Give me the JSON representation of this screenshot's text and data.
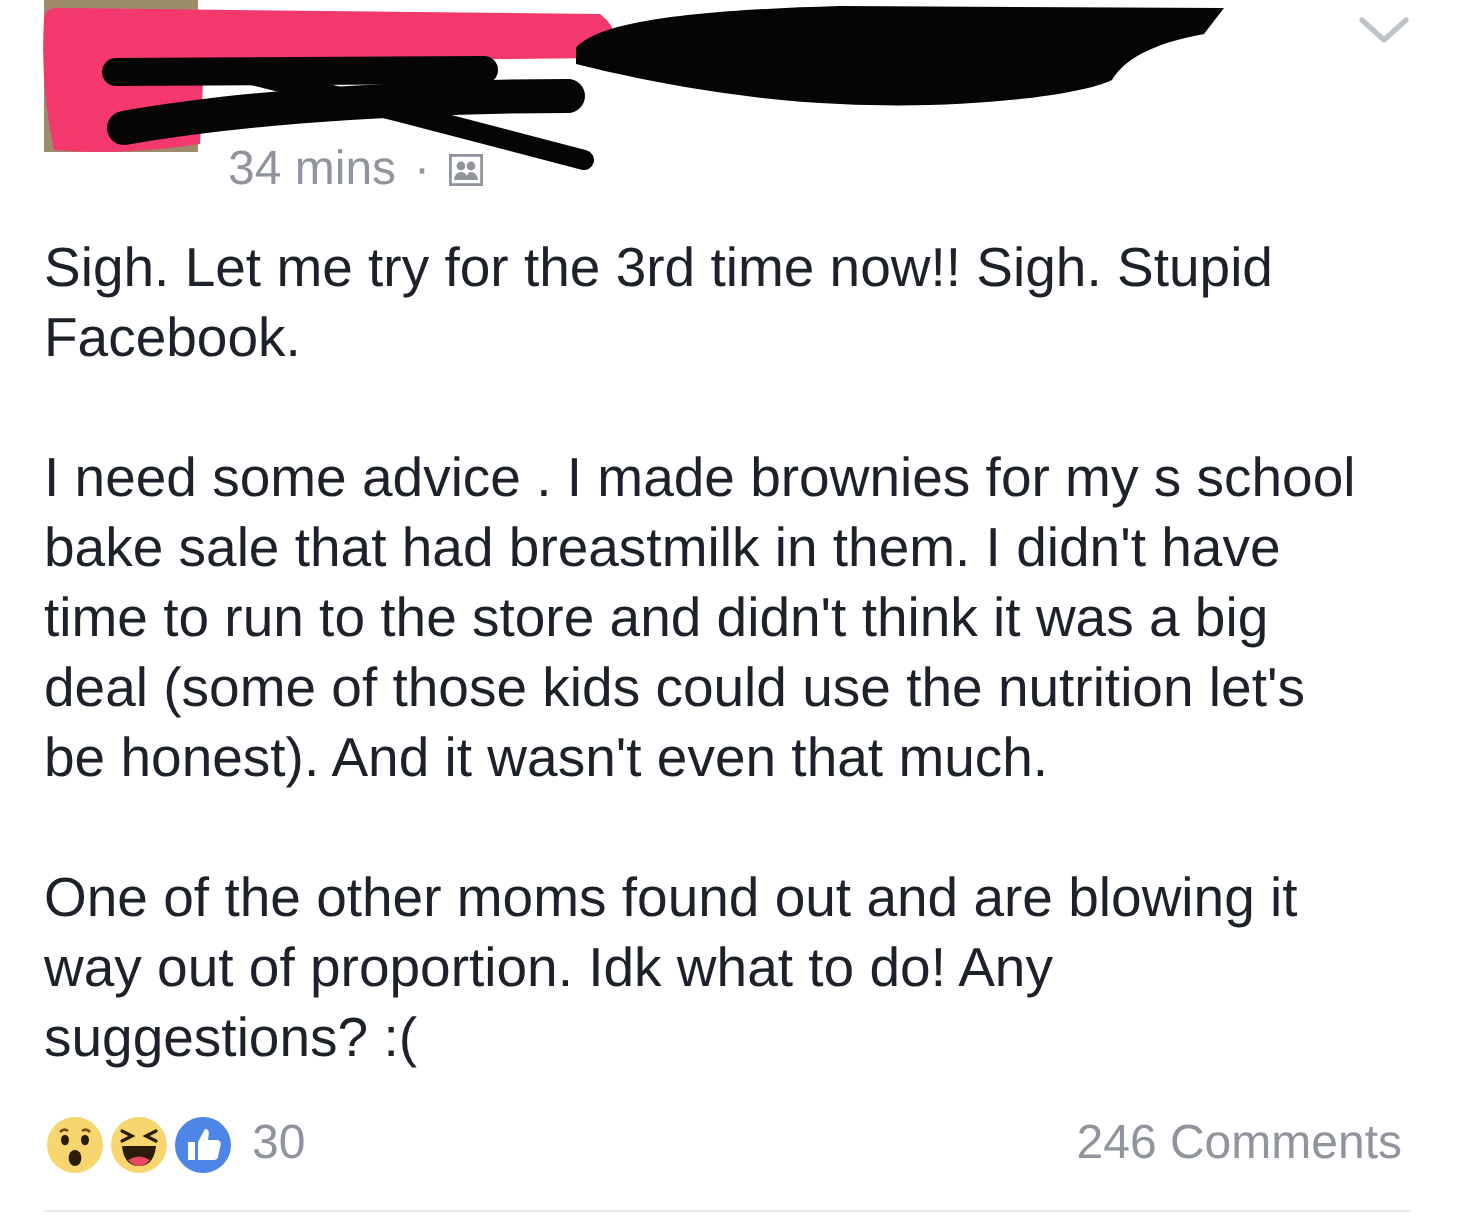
{
  "post": {
    "header": {
      "time": "34 mins",
      "separator": "·"
    },
    "body": {
      "paragraphs": [
        "Sigh. Let me try for the 3rd time now!! Sigh. Stupid Facebook.",
        "I need some advice . I made brownies for my s school bake sale that had breastmilk in them. I didn't have time to run to the store and didn't think it was a big deal (some of those kids could use the nutrition let's be honest). And it wasn't even that much.",
        "One of the other moms found out and are blowing it way out of proportion. Idk what to do! Any suggestions? :("
      ]
    },
    "footer": {
      "reactions": [
        {
          "kind": "wow"
        },
        {
          "kind": "haha"
        },
        {
          "kind": "like"
        }
      ],
      "reaction_count": "30",
      "comments": "246 Comments"
    }
  }
}
